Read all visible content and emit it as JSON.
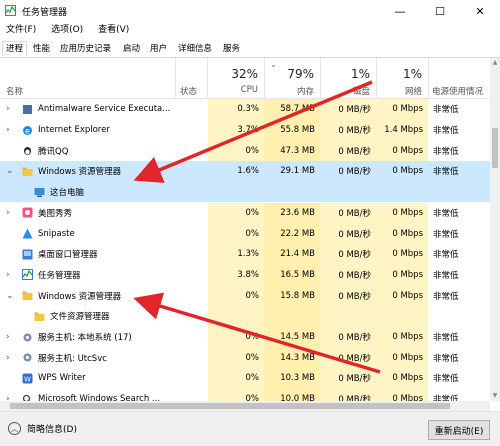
{
  "window": {
    "title": "任务管理器",
    "minimize": "—",
    "maximize": "☐",
    "close": "✕"
  },
  "menu": [
    "文件(F)",
    "选项(O)",
    "查看(V)"
  ],
  "tabs": [
    "进程",
    "性能",
    "应用历史记录",
    "启动",
    "用户",
    "详细信息",
    "服务"
  ],
  "header": {
    "name": "名称",
    "status": "状态",
    "cpu_pct": "32%",
    "cpu": "CPU",
    "mem_pct": "79%",
    "mem": "内存",
    "disk_pct": "1%",
    "disk": "磁盘",
    "net_pct": "1%",
    "net": "网络",
    "power": "电源使用情况"
  },
  "rows": [
    {
      "name": "Antimalware Service Executa...",
      "cpu": "0.3%",
      "mem": "58.7 MB",
      "disk": "0 MB/秒",
      "net": "0 Mbps",
      "power": "非常低",
      "expander": "›",
      "icon": "shield-icon"
    },
    {
      "name": "Internet Explorer",
      "cpu": "3.7%",
      "mem": "55.8 MB",
      "disk": "0 MB/秒",
      "net": "1.4 Mbps",
      "power": "非常低",
      "expander": "›",
      "icon": "ie-icon"
    },
    {
      "name": "腾讯QQ",
      "cpu": "0%",
      "mem": "47.3 MB",
      "disk": "0 MB/秒",
      "net": "0 Mbps",
      "power": "非常低",
      "expander": "",
      "icon": "qq-icon"
    },
    {
      "name": "Windows 资源管理器",
      "cpu": "1.6%",
      "mem": "29.1 MB",
      "disk": "0 MB/秒",
      "net": "0 Mbps",
      "power": "非常低",
      "expander": "⌄",
      "icon": "folder-icon",
      "selected": true
    },
    {
      "name": "这台电脑",
      "cpu": "",
      "mem": "",
      "disk": "",
      "net": "",
      "power": "",
      "expander": "",
      "icon": "computer-icon",
      "child": true,
      "selected": true
    },
    {
      "name": "美图秀秀",
      "cpu": "0%",
      "mem": "23.6 MB",
      "disk": "0 MB/秒",
      "net": "0 Mbps",
      "power": "非常低",
      "expander": "›",
      "icon": "meitu-icon"
    },
    {
      "name": "Snipaste",
      "cpu": "0%",
      "mem": "22.2 MB",
      "disk": "0 MB/秒",
      "net": "0 Mbps",
      "power": "非常低",
      "expander": "",
      "icon": "snipaste-icon"
    },
    {
      "name": "桌面窗口管理器",
      "cpu": "1.3%",
      "mem": "21.4 MB",
      "disk": "0 MB/秒",
      "net": "0 Mbps",
      "power": "非常低",
      "expander": "",
      "icon": "dwm-icon"
    },
    {
      "name": "任务管理器",
      "cpu": "3.8%",
      "mem": "16.5 MB",
      "disk": "0 MB/秒",
      "net": "0 Mbps",
      "power": "非常低",
      "expander": "›",
      "icon": "taskmgr-icon"
    },
    {
      "name": "Windows 资源管理器",
      "cpu": "0%",
      "mem": "15.8 MB",
      "disk": "0 MB/秒",
      "net": "0 Mbps",
      "power": "非常低",
      "expander": "⌄",
      "icon": "folder-icon"
    },
    {
      "name": "文件资源管理器",
      "cpu": "",
      "mem": "",
      "disk": "",
      "net": "",
      "power": "",
      "expander": "",
      "icon": "folder-icon",
      "child": true
    },
    {
      "name": "服务主机: 本地系统 (17)",
      "cpu": "0%",
      "mem": "14.5 MB",
      "disk": "0 MB/秒",
      "net": "0 Mbps",
      "power": "非常低",
      "expander": "›",
      "icon": "gear-icon"
    },
    {
      "name": "服务主机: UtcSvc",
      "cpu": "0%",
      "mem": "14.3 MB",
      "disk": "0 MB/秒",
      "net": "0 Mbps",
      "power": "非常低",
      "expander": "›",
      "icon": "gear-icon"
    },
    {
      "name": "WPS Writer",
      "cpu": "0%",
      "mem": "10.3 MB",
      "disk": "0 MB/秒",
      "net": "0 Mbps",
      "power": "非常低",
      "expander": "",
      "icon": "wps-icon"
    },
    {
      "name": "Microsoft Windows Search ...",
      "cpu": "0%",
      "mem": "10.0 MB",
      "disk": "0 MB/秒",
      "net": "0 Mbps",
      "power": "非常低",
      "expander": "›",
      "icon": "search-icon"
    }
  ],
  "footer": {
    "fewer": "简略信息(D)",
    "restart": "重新启动(E)"
  },
  "colors": {
    "selected": "#cce8ff",
    "heat": "#fff4c4",
    "arrow": "#e0262a"
  }
}
